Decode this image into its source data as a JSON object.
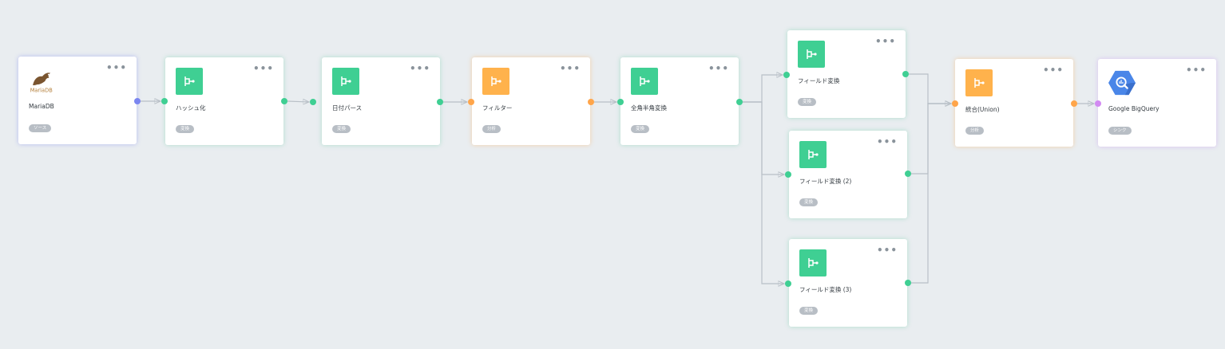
{
  "nodes": [
    {
      "id": "mariadb",
      "title": "MariaDB",
      "badge": "ソース",
      "icon": "mariadb-logo-icon",
      "logo_text": "MariaDB",
      "more": "•••",
      "colors": {
        "accent": "#7b86f0"
      }
    },
    {
      "id": "hash",
      "title": "ハッシュ化",
      "badge": "変換",
      "icon": "transform-icon",
      "more": "•••",
      "colors": {
        "accent": "#3fcf93"
      }
    },
    {
      "id": "dateparse",
      "title": "日付パース",
      "badge": "変換",
      "icon": "transform-icon",
      "more": "•••",
      "colors": {
        "accent": "#3fcf93"
      }
    },
    {
      "id": "filter",
      "title": "フィルター",
      "badge": "分析",
      "icon": "transform-icon",
      "more": "•••",
      "colors": {
        "accent": "#ffb24c"
      }
    },
    {
      "id": "zenhan",
      "title": "全角半角変換",
      "badge": "変換",
      "icon": "transform-icon",
      "more": "•••",
      "colors": {
        "accent": "#3fcf93"
      }
    },
    {
      "id": "field1",
      "title": "フィールド変換",
      "badge": "変換",
      "icon": "transform-icon",
      "more": "•••",
      "colors": {
        "accent": "#3fcf93"
      }
    },
    {
      "id": "field2",
      "title": "フィールド変換 (2)",
      "badge": "変換",
      "icon": "transform-icon",
      "more": "•••",
      "colors": {
        "accent": "#3fcf93"
      }
    },
    {
      "id": "field3",
      "title": "フィールド変換 (3)",
      "badge": "変換",
      "icon": "transform-icon",
      "more": "•••",
      "colors": {
        "accent": "#3fcf93"
      }
    },
    {
      "id": "union",
      "title": "統合(Union)",
      "badge": "分析",
      "icon": "transform-icon",
      "more": "•••",
      "colors": {
        "accent": "#ffb24c"
      }
    },
    {
      "id": "bigquery",
      "title": "Google BigQuery",
      "badge": "シンク",
      "icon": "bigquery-icon",
      "more": "•••",
      "colors": {
        "accent": "#d28af2"
      }
    }
  ],
  "edges": [
    [
      "mariadb",
      "hash"
    ],
    [
      "hash",
      "dateparse"
    ],
    [
      "dateparse",
      "filter"
    ],
    [
      "filter",
      "zenhan"
    ],
    [
      "zenhan",
      "field1"
    ],
    [
      "zenhan",
      "field2"
    ],
    [
      "zenhan",
      "field3"
    ],
    [
      "field1",
      "union"
    ],
    [
      "field2",
      "union"
    ],
    [
      "field3",
      "union"
    ],
    [
      "union",
      "bigquery"
    ]
  ]
}
